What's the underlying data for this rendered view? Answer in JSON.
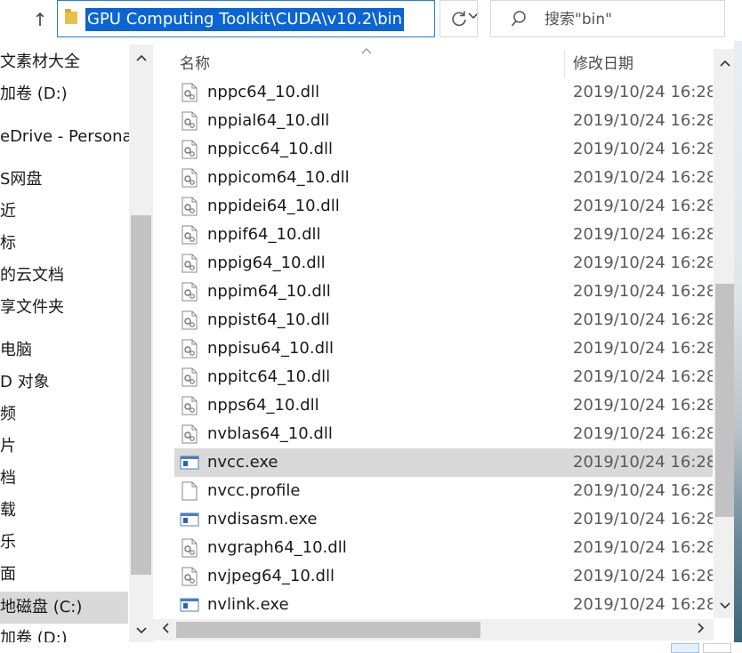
{
  "address_bar": {
    "path": "GPU Computing Toolkit\\CUDA\\v10.2\\bin",
    "search_placeholder": "搜索\"bin\""
  },
  "icons": {
    "up": "arrow-up-icon",
    "folder": "folder-icon",
    "dropdown": "chevron-down-icon",
    "refresh": "refresh-icon",
    "search": "search-icon",
    "dll": "dll-gear-icon",
    "exe": "exe-window-icon",
    "file": "blank-file-icon"
  },
  "nav_pane": {
    "items": [
      {
        "label": "文素材大全"
      },
      {
        "label": "加卷 (D:)"
      },
      {
        "label": "eDrive - Personal"
      },
      {
        "label": "S网盘"
      },
      {
        "label": "近"
      },
      {
        "label": "标"
      },
      {
        "label": "的云文档"
      },
      {
        "label": "享文件夹"
      },
      {
        "label": "电脑"
      },
      {
        "label": "D 对象"
      },
      {
        "label": "频"
      },
      {
        "label": "片"
      },
      {
        "label": "档"
      },
      {
        "label": "载"
      },
      {
        "label": "乐"
      },
      {
        "label": "面"
      },
      {
        "label": "地磁盘 (C:)"
      },
      {
        "label": "加卷 (D:)"
      }
    ]
  },
  "file_list": {
    "columns": {
      "name": "名称",
      "modified": "修改日期"
    },
    "files": [
      {
        "name": "nppc64_10.dll",
        "modified": "2019/10/24 16:28",
        "type": "dll"
      },
      {
        "name": "nppial64_10.dll",
        "modified": "2019/10/24 16:28",
        "type": "dll"
      },
      {
        "name": "nppicc64_10.dll",
        "modified": "2019/10/24 16:28",
        "type": "dll"
      },
      {
        "name": "nppicom64_10.dll",
        "modified": "2019/10/24 16:28",
        "type": "dll"
      },
      {
        "name": "nppidei64_10.dll",
        "modified": "2019/10/24 16:28",
        "type": "dll"
      },
      {
        "name": "nppif64_10.dll",
        "modified": "2019/10/24 16:28",
        "type": "dll"
      },
      {
        "name": "nppig64_10.dll",
        "modified": "2019/10/24 16:28",
        "type": "dll"
      },
      {
        "name": "nppim64_10.dll",
        "modified": "2019/10/24 16:28",
        "type": "dll"
      },
      {
        "name": "nppist64_10.dll",
        "modified": "2019/10/24 16:28",
        "type": "dll"
      },
      {
        "name": "nppisu64_10.dll",
        "modified": "2019/10/24 16:28",
        "type": "dll"
      },
      {
        "name": "nppitc64_10.dll",
        "modified": "2019/10/24 16:28",
        "type": "dll"
      },
      {
        "name": "npps64_10.dll",
        "modified": "2019/10/24 16:28",
        "type": "dll"
      },
      {
        "name": "nvblas64_10.dll",
        "modified": "2019/10/24 16:28",
        "type": "dll"
      },
      {
        "name": "nvcc.exe",
        "modified": "2019/10/24 16:28",
        "type": "exe",
        "hover": true
      },
      {
        "name": "nvcc.profile",
        "modified": "2019/10/24 16:28",
        "type": "file"
      },
      {
        "name": "nvdisasm.exe",
        "modified": "2019/10/24 16:28",
        "type": "exe"
      },
      {
        "name": "nvgraph64_10.dll",
        "modified": "2019/10/24 16:28",
        "type": "dll"
      },
      {
        "name": "nvjpeg64_10.dll",
        "modified": "2019/10/24 16:28",
        "type": "dll"
      },
      {
        "name": "nvlink.exe",
        "modified": "2019/10/24 16:28",
        "type": "exe"
      }
    ]
  },
  "colors": {
    "address_highlight": "#0a64d4",
    "address_border": "#2b7bd8",
    "row_hover": "#d9d9d9",
    "scroll_thumb": "#c2c2c2"
  }
}
